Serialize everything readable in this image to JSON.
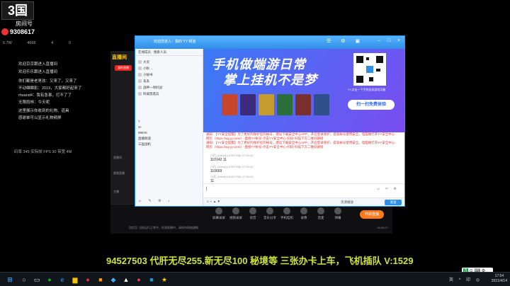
{
  "room": {
    "logo": "3国",
    "label": "房间号",
    "number": "9308617"
  },
  "left_overlay": {
    "stats_row": [
      "6.7W",
      "4666",
      "4",
      "0"
    ],
    "messages": [
      "欢迎京京跟进入直播间",
      "欢迎乐乐跟进入直播间",
      "你们都是老男孩：又来了，又来了",
      "不动雄瞬影：2019，大家都好起来了",
      "rhsand4：我有急事，打不了了",
      "无限雨林：今天呢",
      "这里展示你收到的礼物、道具",
      "感谢单可以显示礼物频屏"
    ],
    "footer": "码率 345  实际帧 FPS 30  带宽 4M"
  },
  "yy_bg": {
    "brand": "直播间",
    "live_btn": "我的直播",
    "side": [
      "直播间",
      "视频直播",
      "主播"
    ]
  },
  "chat_window": {
    "title": "欢迎您进入：我的 YY 频道",
    "members": {
      "tabs": "在线成员 · 搜索人员",
      "rows": [
        "大灵",
        "小秋 ...",
        "小秘书",
        "丢丢",
        "战神一场好战",
        "阿威悠悠兵"
      ],
      "group_rows": [
        "?",
        "3+",
        "9997K",
        "直播频道",
        "三国战机"
      ]
    },
    "banner": {
      "line1": "手机做端游日常",
      "line2": "掌上挂机不是梦",
      "qr_caption": "YY点击一下手机挂机游戏功能",
      "scan_button": "扫一扫免费体验"
    },
    "messages": [
      {
        "kind": "sys",
        "text": "通知：【YY安全提醒】为了更好的保护您的帐号，建议下载安全中心APP，开启登录保护，提高帐号使用安全。电脑端打开YY安全中心网页（https://aq.yy.com/）-直接YY帐号-点击YY安全中心-扫码-扫描下方二维码链接"
      },
      {
        "kind": "sys",
        "text": "通知：【YY安全提醒】为了更好的保护您的帐号，建议下载安全中心APP，开启登录保护，提高帐号使用安全。电脑端打开YY安全中心网页（https://aq.yy.com/）-直接YY帐号-点击YY安全中心-扫码-扫描下方二维码链接"
      },
      {
        "kind": "meta",
        "text": "小迟_IDebe(121997708) 17:26:24"
      },
      {
        "kind": "body",
        "text": "110142 11"
      },
      {
        "kind": "meta",
        "text": "小迟_IDebe(121997708) 17:26:24"
      },
      {
        "kind": "body",
        "text": "110669"
      },
      {
        "kind": "meta",
        "text": "小迟_IDebe(121997708) 17:26:24"
      },
      {
        "kind": "body",
        "text": "11"
      }
    ],
    "footer": {
      "history": "资源播放",
      "send": "发送"
    }
  },
  "toolbar": {
    "items": [
      "屏幕录屏",
      "视频录屏",
      "语音",
      "音乐分享",
      "手机挂机",
      "录像",
      "连麦",
      "弹幕",
      "关闭",
      "分享"
    ],
    "start_btn": "开启直播",
    "status": "【首页】当前运行正常中，检测直播中，请保持网络通畅",
    "time": "06:05:27"
  },
  "marquee": "94527503  代肝无尽255.新无尽100 秘境等   三张办卡上车，飞机插队 V:1529",
  "taskbar": {
    "ime": "五",
    "tray": "英 ^ 印 ◎",
    "time": "17:54",
    "date": "2021/4/14"
  }
}
